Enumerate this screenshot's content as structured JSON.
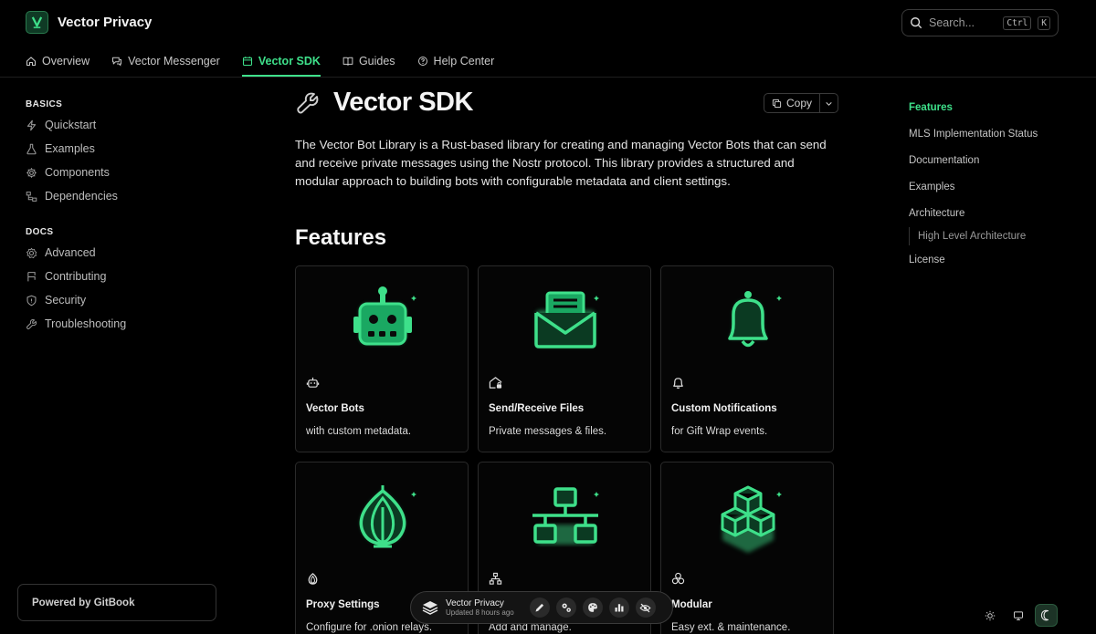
{
  "brand": {
    "name": "Vector Privacy"
  },
  "search": {
    "placeholder": "Search...",
    "key1": "Ctrl",
    "key2": "K"
  },
  "topnav": [
    {
      "label": "Overview",
      "icon": "home-icon"
    },
    {
      "label": "Vector Messenger",
      "icon": "chat-icon"
    },
    {
      "label": "Vector SDK",
      "icon": "calendar-icon"
    },
    {
      "label": "Guides",
      "icon": "book-icon"
    },
    {
      "label": "Help Center",
      "icon": "help-icon"
    }
  ],
  "sidebar": {
    "basics_title": "BASICS",
    "basics": [
      {
        "label": "Quickstart",
        "icon": "bolt-icon"
      },
      {
        "label": "Examples",
        "icon": "flask-icon"
      },
      {
        "label": "Components",
        "icon": "gear-icon"
      },
      {
        "label": "Dependencies",
        "icon": "sitemap-icon"
      }
    ],
    "docs_title": "DOCS",
    "docs": [
      {
        "label": "Advanced",
        "icon": "cog-icon"
      },
      {
        "label": "Contributing",
        "icon": "code-branch-icon"
      },
      {
        "label": "Security",
        "icon": "shield-icon"
      },
      {
        "label": "Troubleshooting",
        "icon": "wrench-icon"
      }
    ],
    "powered": "Powered by GitBook"
  },
  "main": {
    "title": "Vector SDK",
    "copy_label": "Copy",
    "intro": "The Vector Bot Library is a Rust-based library for creating and managing Vector Bots that can send and receive private messages using the Nostr protocol. This library provides a structured and modular approach to building bots with configurable metadata and client settings.",
    "features_heading": "Features",
    "cards": [
      {
        "title": "Vector Bots",
        "desc": "with custom metadata.",
        "icon": "robot-icon"
      },
      {
        "title": "Send/Receive Files",
        "desc": "Private messages & files.",
        "icon": "mail-icon"
      },
      {
        "title": "Custom Notifications",
        "desc": "for Gift Wrap events.",
        "icon": "bell-icon"
      },
      {
        "title": "Proxy Settings",
        "desc": "Configure for .onion relays.",
        "icon": "onion-icon"
      },
      {
        "title": "",
        "desc": "Add and manage.",
        "icon": "network-icon"
      },
      {
        "title": "Modular",
        "desc": "Easy ext. & maintenance.",
        "icon": "cubes-icon"
      }
    ]
  },
  "toc": {
    "items": [
      "Features",
      "MLS Implementation Status",
      "Documentation",
      "Examples",
      "Architecture"
    ],
    "sub": "High Level Architecture",
    "last": "License"
  },
  "floatbar": {
    "name": "Vector Privacy",
    "updated": "Updated 8 hours ago"
  },
  "colors": {
    "accent": "#3ee08a",
    "background": "#000000"
  }
}
